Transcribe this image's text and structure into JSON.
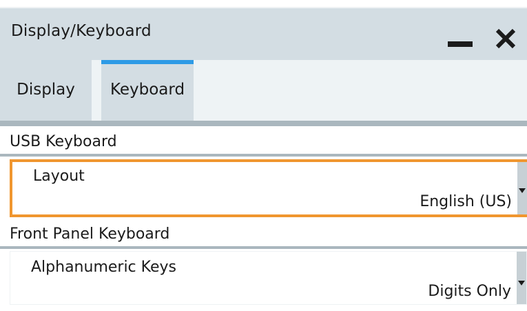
{
  "window": {
    "title": "Display/Keyboard",
    "minimize_icon": "minimize-icon",
    "close_icon": "close-icon"
  },
  "tabs": [
    {
      "label": "Display",
      "active": false
    },
    {
      "label": "Keyboard",
      "active": true
    }
  ],
  "usb_keyboard": {
    "header": "USB Keyboard",
    "layout": {
      "label": "Layout",
      "value": "English (US)",
      "focused": true
    }
  },
  "front_panel_keyboard": {
    "header": "Front Panel Keyboard",
    "alphanumeric_keys": {
      "label": "Alphanumeric Keys",
      "value": "Digits Only"
    }
  },
  "colors": {
    "titlebar": "#d3dde3",
    "active_tab_indicator": "#2e9be6",
    "focus_border": "#f0962f",
    "section_line": "#aab7be"
  }
}
